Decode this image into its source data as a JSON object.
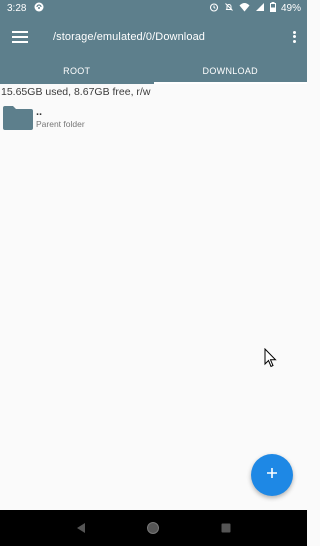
{
  "status_bar": {
    "time": "3:28",
    "battery": "49%",
    "icons": [
      "sync-icon",
      "alarm-icon",
      "notifications-off-icon",
      "wifi-icon",
      "signal-icon",
      "battery-icon"
    ]
  },
  "toolbar": {
    "menu_icon": "hamburger-icon",
    "title": "/storage/emulated/0/Download",
    "overflow_icon": "more-vertical-icon"
  },
  "tabs": [
    {
      "label": "ROOT",
      "active": false
    },
    {
      "label": "DOWNLOAD",
      "active": true
    }
  ],
  "storage": {
    "info": "15.65GB used, 8.67GB free, r/w"
  },
  "files": [
    {
      "name": "..",
      "subtitle": "Parent folder",
      "icon": "folder-icon"
    }
  ],
  "fab": {
    "icon": "plus-icon"
  },
  "colors": {
    "appbar": "#5d7f8c",
    "fab": "#1e88e5",
    "folder": "#5d7f8c",
    "background": "#fafafa"
  }
}
